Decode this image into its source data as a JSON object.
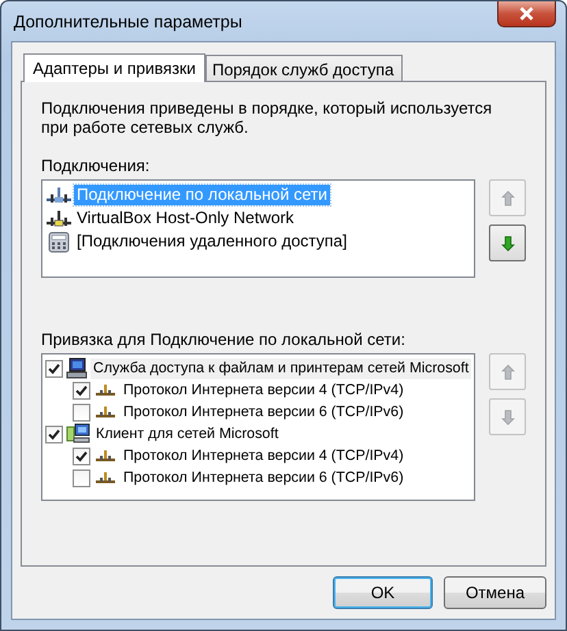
{
  "window": {
    "title": "Дополнительные параметры"
  },
  "tabs": [
    {
      "label": "Адаптеры и привязки",
      "selected": true
    },
    {
      "label": "Порядок служб доступа",
      "selected": false
    }
  ],
  "description": "Подключения приведены в порядке, который используется при работе сетевых служб.",
  "connections": {
    "label": "Подключения:",
    "items": [
      {
        "label": "Подключение по локальной сети",
        "kind": "network",
        "selected": true
      },
      {
        "label": "VirtualBox Host-Only Network",
        "kind": "adapter",
        "selected": false
      },
      {
        "label": "[Подключения удаленного доступа]",
        "kind": "dialup",
        "selected": false
      }
    ],
    "move_up": {
      "disabled": true
    },
    "move_down": {
      "disabled": false
    }
  },
  "bindings": {
    "label": "Привязка для Подключение по локальной сети:",
    "items": [
      {
        "label": "Служба доступа к файлам и принтерам сетей Microsoft",
        "kind": "service",
        "checked": true,
        "selected": true,
        "children": [
          {
            "label": "Протокол Интернета версии 4 (TCP/IPv4)",
            "kind": "protocol",
            "checked": true,
            "selected": false
          },
          {
            "label": "Протокол Интернета версии 6 (TCP/IPv6)",
            "kind": "protocol",
            "checked": false,
            "selected": false
          }
        ]
      },
      {
        "label": "Клиент для сетей Microsoft",
        "kind": "client",
        "checked": true,
        "selected": false,
        "children": [
          {
            "label": "Протокол Интернета версии 4 (TCP/IPv4)",
            "kind": "protocol",
            "checked": true,
            "selected": false
          },
          {
            "label": "Протокол Интернета версии 6 (TCP/IPv6)",
            "kind": "protocol",
            "checked": false,
            "selected": false
          }
        ]
      }
    ],
    "move_up": {
      "disabled": true
    },
    "move_down": {
      "disabled": true
    }
  },
  "buttons": [
    {
      "label": "OK",
      "kind": "default"
    },
    {
      "label": "Отмена",
      "kind": "normal"
    }
  ]
}
